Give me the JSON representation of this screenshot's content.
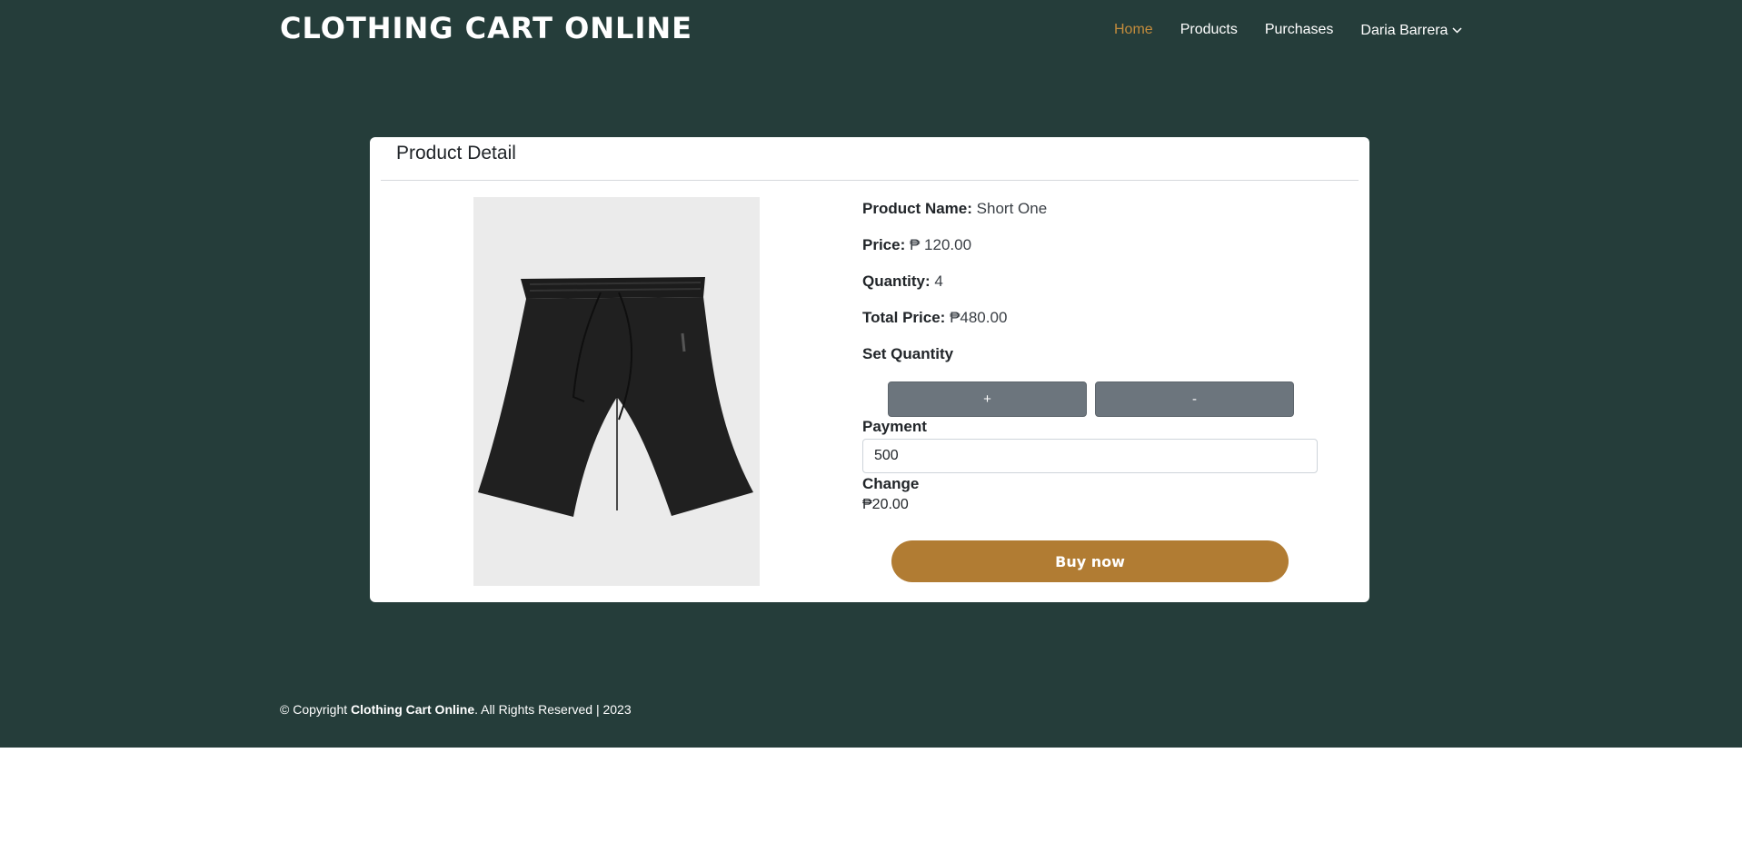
{
  "header": {
    "brand": "CLOTHING CART ONLINE",
    "nav": {
      "home": "Home",
      "products": "Products",
      "purchases": "Purchases",
      "user": "Daria Barrera"
    }
  },
  "card": {
    "title": "Product Detail",
    "product_name_label": "Product Name:",
    "product_name": "Short One",
    "price_label": "Price:",
    "price": "₱ 120.00",
    "quantity_label": "Quantity:",
    "quantity": "4",
    "total_label": "Total Price:",
    "total": "₱480.00",
    "set_quantity_label": "Set Quantity",
    "plus_label": "+",
    "minus_label": "-",
    "payment_label": "Payment",
    "payment_value": "500",
    "change_label": "Change",
    "change_value": "₱20.00",
    "buy_label": "Buy now"
  },
  "footer": {
    "prefix": "© Copyright ",
    "brand": "Clothing Cart Online",
    "suffix": ". All Rights Reserved | 2023"
  },
  "colors": {
    "background": "#253d3a",
    "accent": "#c28b3c",
    "buy_button": "#b17c33",
    "qty_button": "#6c757d"
  }
}
